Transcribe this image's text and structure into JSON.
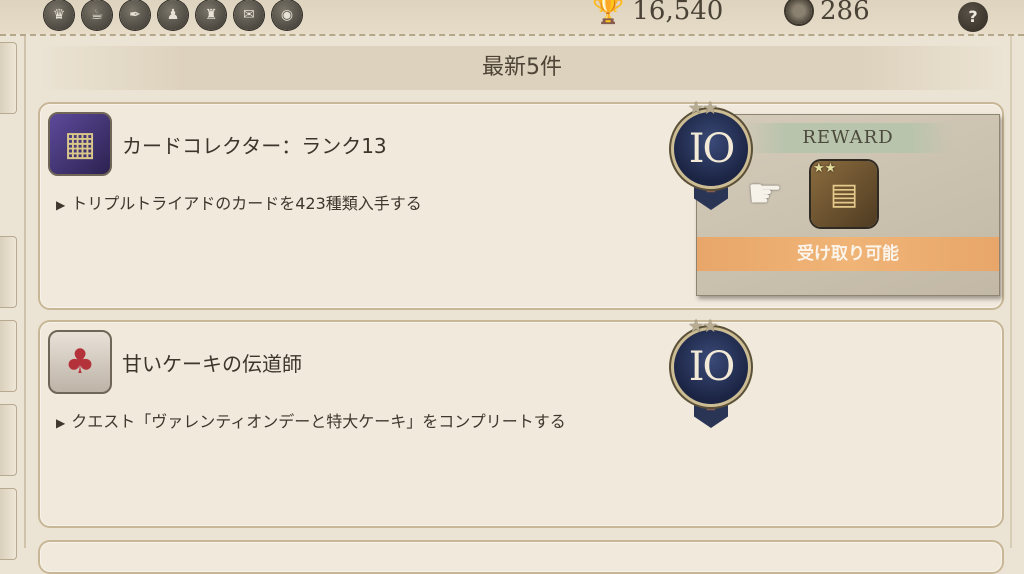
{
  "top_bar": {
    "category_icons": [
      "trophy-icon",
      "cup-icon",
      "feather-icon",
      "figure-icon",
      "armor-icon",
      "map-icon",
      "medal-icon"
    ],
    "achievement_points": "16,540",
    "completed_count": "286",
    "help_label": "?"
  },
  "section": {
    "title": "最新5件"
  },
  "achievements": [
    {
      "icon": "card-book-icon",
      "title": "カードコレクター：ランク13",
      "description": "トリプルトライアドのカードを423種類入手する",
      "rank": "IO",
      "stars": "★★",
      "reward": {
        "header": "REWARD",
        "item_icon": "map-scroll-icon",
        "item_stars": "★★",
        "claim_label": "受け取り可能"
      }
    },
    {
      "icon": "cake-icon",
      "title": "甘いケーキの伝道師",
      "description": "クエスト「ヴァレンティオンデーと特大ケーキ」をコンプリートする",
      "rank": "IO",
      "stars": "★★"
    }
  ]
}
